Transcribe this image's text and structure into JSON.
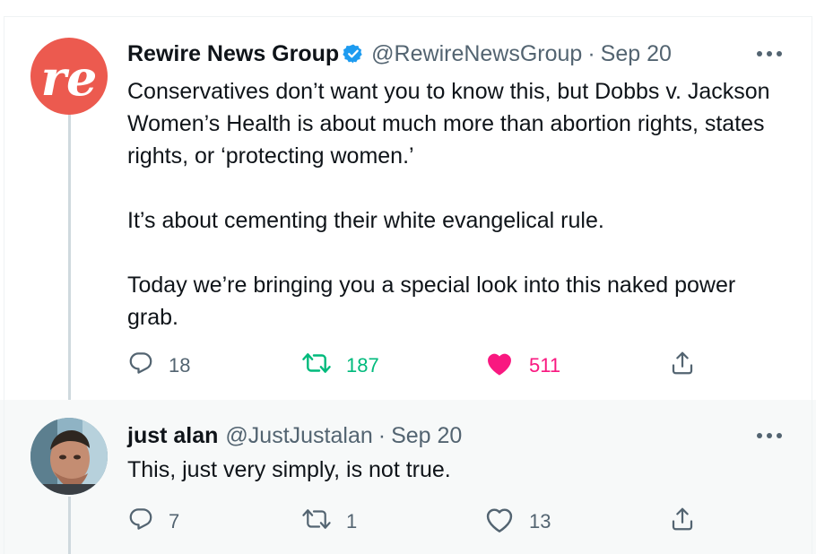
{
  "tweets": [
    {
      "author_name": "Rewire News Group",
      "verified": true,
      "handle": "@RewireNewsGroup",
      "separator": "·",
      "date": "Sep 20",
      "avatar_text": "re",
      "paragraphs": [
        "Conservatives don’t want you to know this, but Dobbs v. Jackson Women’s Health is about much more than abortion rights, states rights, or ‘protecting women.’",
        "It’s about cementing their white evangelical rule.",
        "Today we’re bringing you a special look into this naked power grab."
      ],
      "replies": "18",
      "retweets": "187",
      "likes": "511",
      "retweeted": true,
      "liked": true
    },
    {
      "author_name": "just alan",
      "verified": false,
      "handle": "@JustJustalan",
      "separator": "·",
      "date": "Sep 20",
      "paragraphs": [
        "This, just very simply, is not true."
      ],
      "replies": "7",
      "retweets": "1",
      "likes": "13",
      "retweeted": false,
      "liked": false
    }
  ],
  "colors": {
    "brand_red": "#ec5a4f",
    "verified_blue": "#1d9bf0",
    "retweet_green": "#00ba7c",
    "like_pink": "#f91880",
    "muted_gray": "#536471"
  },
  "icons": [
    "more-icon",
    "reply-icon",
    "retweet-icon",
    "like-icon",
    "share-icon",
    "verified-badge-icon"
  ]
}
